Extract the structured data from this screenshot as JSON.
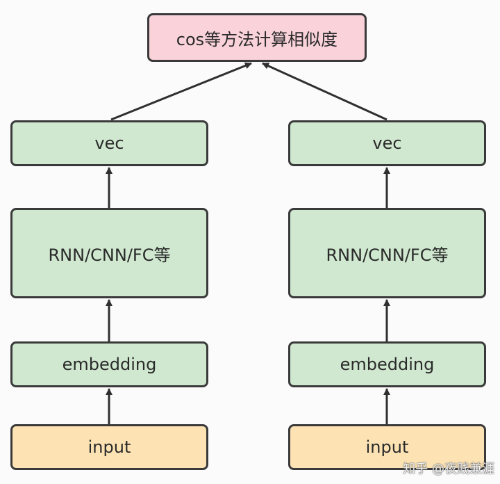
{
  "top_box": {
    "label": "cos等方法计算相似度"
  },
  "left_tower": {
    "vec": "vec",
    "encoder": "RNN/CNN/FC等",
    "embedding": "embedding",
    "input": "input"
  },
  "right_tower": {
    "vec": "vec",
    "encoder": "RNN/CNN/FC等",
    "embedding": "embedding",
    "input": "input"
  },
  "watermark": "知乎 @夜贱兼涯",
  "colors": {
    "box_green": "#cfe8cf",
    "box_yellow": "#fde3b4",
    "box_pink": "#f9d2da",
    "stroke": "#3a3a3a"
  }
}
